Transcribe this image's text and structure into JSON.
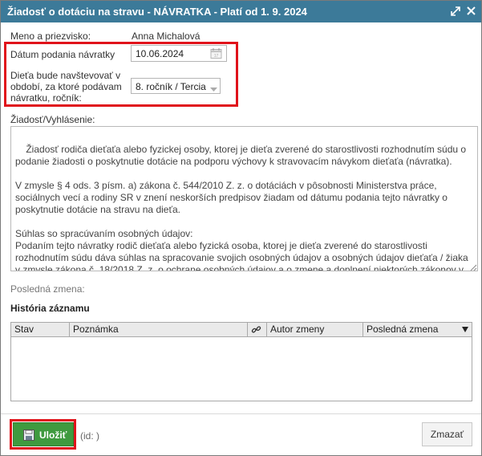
{
  "window": {
    "title": "Žiadosť o dotáciu na stravu - NÁVRATKA - Platí od 1. 9. 2024",
    "maximize_icon": "expand-icon",
    "close_icon": "close-icon"
  },
  "form": {
    "name_label": "Meno a priezvisko:",
    "name_value": "Anna Michalová",
    "date_label": "Dátum podania návratky",
    "date_value": "10.06.2024",
    "grade_label_line1": "Dieťa bude navštevovať v",
    "grade_label_line2": "období, za ktoré podávam",
    "grade_label_line3": "návratku, ročník:",
    "grade_value": "8. ročník / Tercia",
    "request_label": "Žiadosť/Vyhlásenie:",
    "request_text": "Žiadosť rodiča dieťaťa alebo fyzickej osoby, ktorej je dieťa zverené do starostlivosti rozhodnutím súdu o podanie žiadosti o poskytnutie dotácie na podporu výchovy k stravovacím návykom dieťaťa (návratka).\n\nV zmysle § 4 ods. 3 písm. a) zákona č. 544/2010 Z. z. o dotáciách v pôsobnosti Ministerstva práce, sociálnych vecí a rodiny SR v znení neskorších predpisov žiadam od dátumu podania tejto návratky o poskytnutie dotácie na stravu na dieťa.\n\nSúhlas so spracúvaním osobných údajov:\nPodaním tejto návratky rodič dieťaťa alebo fyzická osoba, ktorej je dieťa zverené do starostlivosti rozhodnutím súdu dáva súhlas na spracovanie svojich osobných údajov a osobných údajov dieťaťa / žiaka v zmysle zákona č. 18/2018 Z. z. o ochrane osobných údajov a o zmene a doplnení niektorých zákonov v znení neskorších predpisov.",
    "last_change_label": "Posledná zmena:"
  },
  "history": {
    "title": "História záznamu",
    "columns": {
      "stav": "Stav",
      "poznamka": "Poznámka",
      "link_icon": "link-icon",
      "autor": "Autor zmeny",
      "posledna": "Posledná zmena",
      "sort_icon": "dropdown-arrow-icon"
    }
  },
  "footer": {
    "save_label": "Uložiť",
    "id_text": "(id: )",
    "delete_label": "Zmazať"
  },
  "colors": {
    "titlebar": "#3c7a99",
    "highlight": "#e0131b",
    "save_button": "#3f9a3f"
  }
}
